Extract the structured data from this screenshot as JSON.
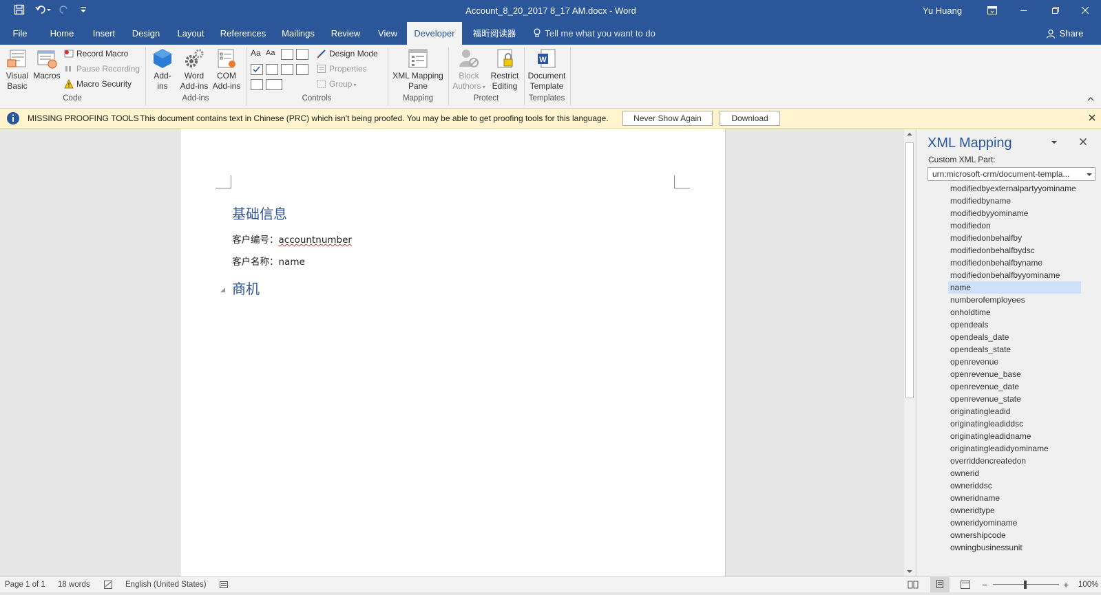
{
  "titlebar": {
    "document_title": "Account_8_20_2017 8_17 AM.docx  -  Word",
    "user": "Yu Huang"
  },
  "tabs": [
    "File",
    "Home",
    "Insert",
    "Design",
    "Layout",
    "References",
    "Mailings",
    "Review",
    "View",
    "Developer",
    "福昕阅读器"
  ],
  "active_tab": "Developer",
  "tell_me": "Tell me what you want to do",
  "share_label": "Share",
  "ribbon": {
    "visual_basic": "Visual Basic",
    "visual_basic_l1": "Visual",
    "visual_basic_l2": "Basic",
    "macros": "Macros",
    "record_macro": "Record Macro",
    "pause_recording": "Pause Recording",
    "macro_security": "Macro Security",
    "code_group": "Code",
    "addins_l1": "Add-",
    "addins_l2": "ins",
    "word_addins_l1": "Word",
    "word_addins_l2": "Add-ins",
    "com_addins_l1": "COM",
    "com_addins_l2": "Add-ins",
    "addins_group": "Add-ins",
    "design_mode": "Design Mode",
    "properties": "Properties",
    "group": "Group",
    "controls_group": "Controls",
    "xml_mapping_l1": "XML Mapping",
    "xml_mapping_l2": "Pane",
    "mapping_group": "Mapping",
    "block_authors_l1": "Block",
    "block_authors_l2": "Authors",
    "restrict_editing_l1": "Restrict",
    "restrict_editing_l2": "Editing",
    "protect_group": "Protect",
    "document_template_l1": "Document",
    "document_template_l2": "Template",
    "templates_group": "Templates"
  },
  "message_bar": {
    "title": "MISSING PROOFING TOOLS",
    "text": "This document contains text in Chinese (PRC) which isn't being proofed. You may be able to get proofing tools for this language.",
    "never_show": "Never Show Again",
    "download": "Download"
  },
  "document": {
    "heading1": "基础信息",
    "line1_label": "客户编号：",
    "line1_value": "accountnumber",
    "line2_label": "客户名称：",
    "line2_value": "name",
    "heading2": "商机"
  },
  "xml_pane": {
    "title": "XML Mapping",
    "custom_part_label": "Custom XML Part:",
    "custom_part_value": "urn:microsoft-crm/document-templa...",
    "nodes": [
      "modifiedbyexternalpartyyominame",
      "modifiedbyname",
      "modifiedbyyominame",
      "modifiedon",
      "modifiedonbehalfby",
      "modifiedonbehalfbydsc",
      "modifiedonbehalfbyname",
      "modifiedonbehalfbyyominame",
      "name",
      "numberofemployees",
      "onholdtime",
      "opendeals",
      "opendeals_date",
      "opendeals_state",
      "openrevenue",
      "openrevenue_base",
      "openrevenue_date",
      "openrevenue_state",
      "originatingleadid",
      "originatingleadiddsc",
      "originatingleadidname",
      "originatingleadidyominame",
      "overriddencreatedon",
      "ownerid",
      "owneriddsc",
      "owneridname",
      "owneridtype",
      "owneridyominame",
      "ownershipcode",
      "owningbusinessunit"
    ],
    "selected_node": "name"
  },
  "status": {
    "page": "Page 1 of 1",
    "words": "18 words",
    "language": "English (United States)",
    "zoom": "100%"
  },
  "colors": {
    "brand": "#2b579a",
    "message_bar": "#fff4ce",
    "heading": "#2f5496",
    "selection": "#cfe0fa"
  }
}
